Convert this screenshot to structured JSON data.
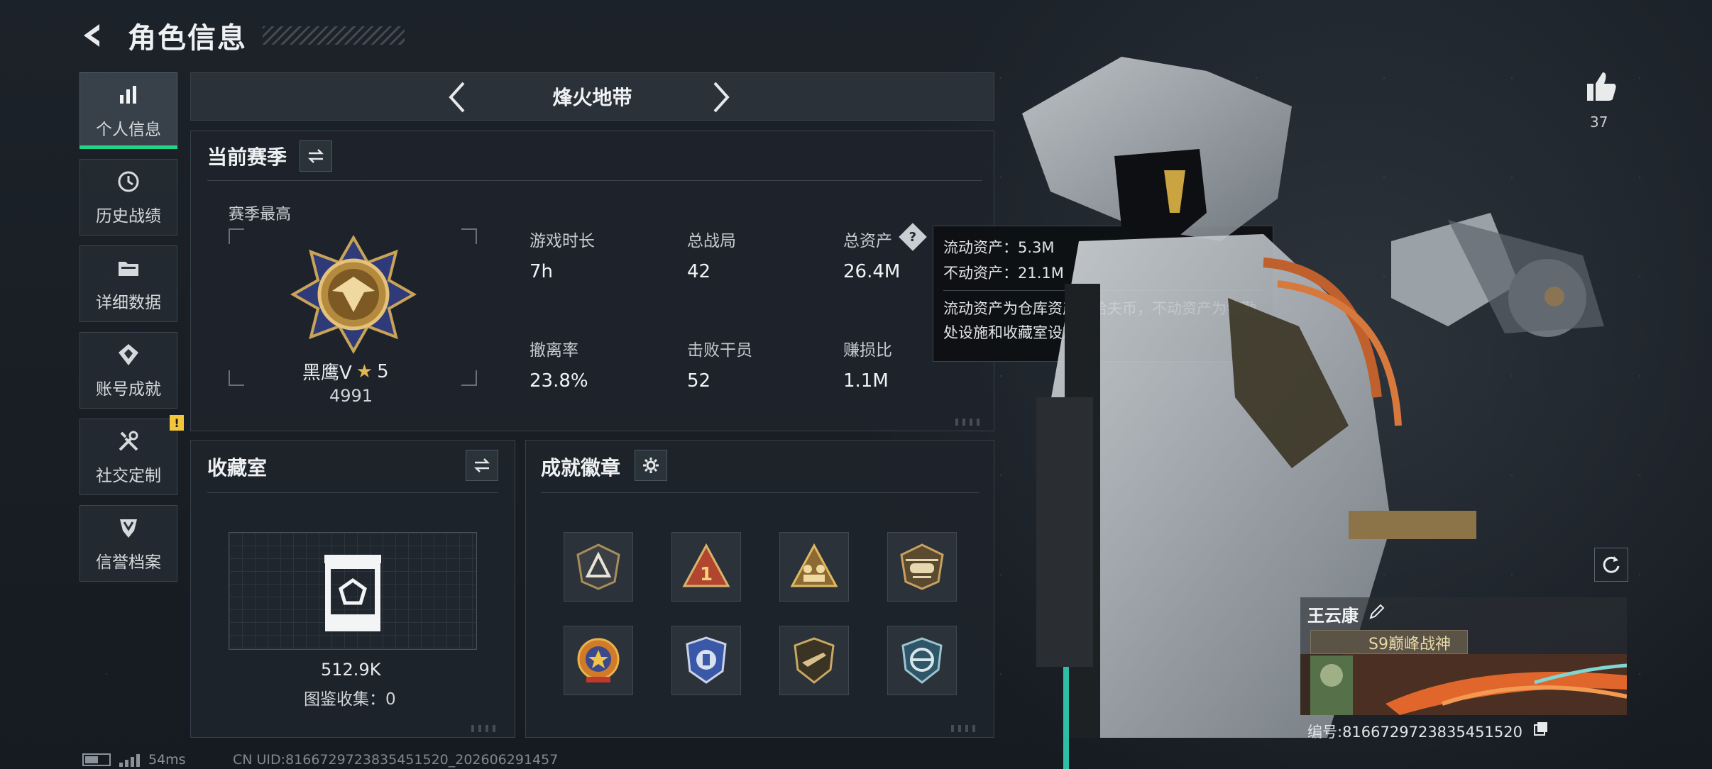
{
  "header": {
    "title": "角色信息"
  },
  "sidebar": {
    "items": [
      {
        "label": "个人信息",
        "icon": "bar-chart-icon",
        "active": true
      },
      {
        "label": "历史战绩",
        "icon": "history-icon"
      },
      {
        "label": "详细数据",
        "icon": "folder-icon"
      },
      {
        "label": "账号成就",
        "icon": "achievement-icon"
      },
      {
        "label": "社交定制",
        "icon": "tools-icon",
        "badge": "!"
      },
      {
        "label": "信誉档案",
        "icon": "credit-shield-icon"
      }
    ]
  },
  "mode": {
    "title": "烽火地带"
  },
  "season": {
    "title": "当前赛季",
    "best_label": "赛季最高",
    "rank_name": "黑鹰V",
    "rank_stars": "5",
    "rank_score": "4991",
    "stats": [
      {
        "label": "游戏时长",
        "value": "7h"
      },
      {
        "label": "总战局",
        "value": "42"
      },
      {
        "label": "总资产",
        "value": "26.4M"
      },
      {
        "label": "撤离率",
        "value": "23.8%"
      },
      {
        "label": "击败干员",
        "value": "52"
      },
      {
        "label": "赚损比",
        "value": "1.1M"
      }
    ]
  },
  "tooltip": {
    "liquid": "流动资产：5.3M",
    "fixed": "不动资产：21.1M",
    "desc": "流动资产为仓库资产和哈夫币，不动资产为特勤处设施和收藏室设施"
  },
  "collection": {
    "title": "收藏室",
    "value": "512.9K",
    "count_label": "图鉴收集：0"
  },
  "badges": {
    "title": "成就徽章",
    "items": [
      "triangle-badge-icon",
      "number-one-badge-icon",
      "squad-badge-icon",
      "helicopter-badge-icon",
      "star-medal-badge-icon",
      "police-badge-icon",
      "gun-shield-badge-icon",
      "eagle-shield-badge-icon"
    ]
  },
  "profile": {
    "likes": "37",
    "name": "王云康",
    "title": "S9巅峰战神",
    "id_label": "编号:8166729723835451520"
  },
  "footer": {
    "ping": "54ms",
    "uid": "CN UID:8166729723835451520_202606291457"
  },
  "colors": {
    "accent": "#22d58a",
    "warning": "#f3c53a",
    "panel": "#1e242b"
  }
}
